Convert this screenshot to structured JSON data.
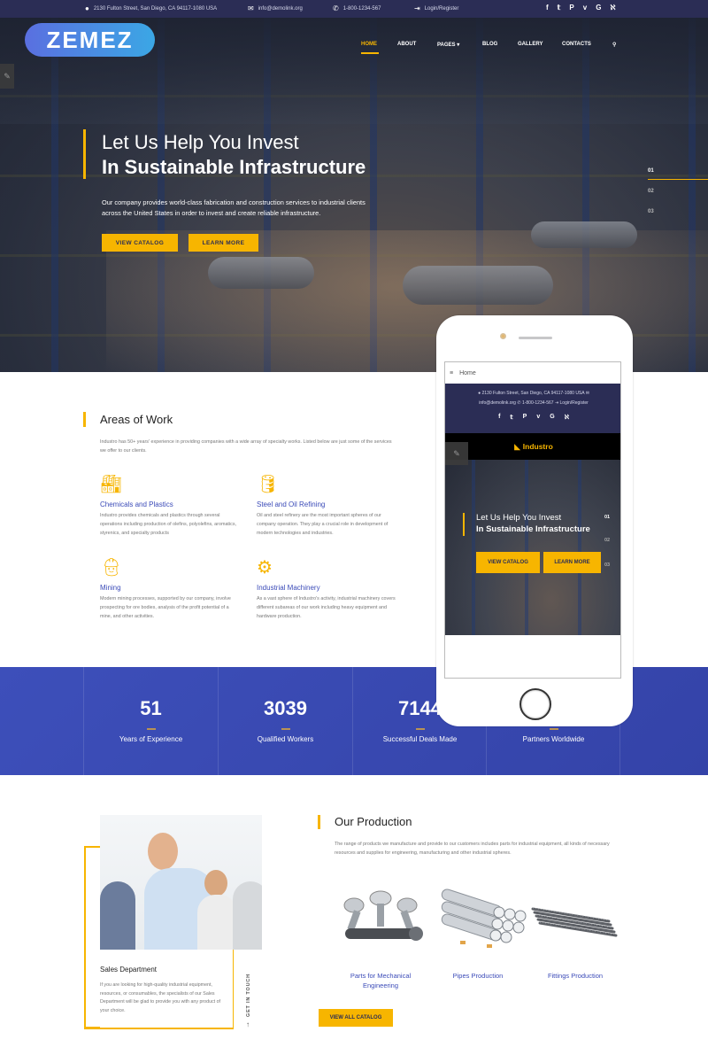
{
  "topbar": {
    "address": "2130 Fulton Street, San Diego, CA 94117-1080 USA",
    "email": "info@demolink.org",
    "phone": "1-800-1234-567",
    "login": "Login/Register",
    "social_icons": [
      "facebook-icon",
      "twitter-icon",
      "pinterest-icon",
      "vimeo-icon",
      "google-icon",
      "rss-icon"
    ],
    "social_glyphs": [
      "f",
      "𝕥",
      "P",
      "v",
      "G",
      "ℵ"
    ]
  },
  "brand": {
    "logo_text": "ZEMEZ"
  },
  "nav": {
    "items": [
      "HOME",
      "ABOUT",
      "PAGES",
      "BLOG",
      "GALLERY",
      "CONTACTS"
    ],
    "active": "HOME",
    "pages_dropdown_glyph": "▾",
    "search_glyph": "⚲"
  },
  "hero": {
    "title_line1": "Let Us Help You Invest",
    "title_line2": "In Sustainable Infrastructure",
    "text": "Our company provides world-class fabrication and construction services to industrial clients across the United States in order to invest and create reliable infrastructure.",
    "buttons": [
      "VIEW CATALOG",
      "LEARN MORE"
    ],
    "slides": [
      "01",
      "02",
      "03"
    ],
    "active_slide": "01"
  },
  "areas": {
    "title": "Areas of Work",
    "intro": "Industro has 50+ years' experience in providing companies with a wide array of specialty works. Listed below are just some of the services we offer to our clients.",
    "items": [
      {
        "icon": "factory-icon",
        "title": "Chemicals and Plastics",
        "text": "Industro provides chemicals and plastics through several operations including production of olefins, polyolefins, aromatics, styrenics, and specialty products"
      },
      {
        "icon": "oil-can-icon",
        "title": "Steel and Oil Refining",
        "text": "Oil and steel refinery are the most important spheres of our company operation. They play a crucial role in development of modern technologies and industries."
      },
      {
        "icon": "worker-helmet-icon",
        "title": "Mining",
        "text": "Modern mining processes, supported by our company, involve prospecting for ore bodies, analysis of the profit potential of a mine, and other activities."
      },
      {
        "icon": "gear-icon",
        "title": "Industrial Machinery",
        "text": "As a vast sphere of Industro's activity, industrial machinery covers different subareas of our work including heavy equipment and hardware production."
      }
    ]
  },
  "stats": [
    {
      "value": "51",
      "label": "Years of Experience"
    },
    {
      "value": "3039",
      "label": "Qualified Workers"
    },
    {
      "value": "7144",
      "label": "Successful Deals Made"
    },
    {
      "value": "",
      "label": "Partners Worldwide"
    }
  ],
  "mobile": {
    "menu_label": "Home",
    "address_line": "2130 Fulton Street, San Diego, CA 94117-1080 USA",
    "contact_line_email": "info@demolink.org",
    "contact_line_phone": "1-800-1234-567",
    "contact_line_login": "Login/Register",
    "brand": "Industro",
    "title_line1": "Let Us Help You Invest",
    "title_line2": "In Sustainable Infrastructure",
    "buttons": [
      "VIEW CATALOG",
      "LEARN MORE"
    ],
    "slides": [
      "01",
      "02",
      "03"
    ]
  },
  "sales": {
    "title": "Sales Department",
    "text": "If you are looking for high-quality industrial equipment, resources, or consumables, the specialists of our Sales Department will be glad to provide you with any product of your choice.",
    "get_in_touch": "GET IN TOUCH"
  },
  "production": {
    "title": "Our Production",
    "intro": "The range of products we manufacture and provide to our customers includes parts for industrial equipment, all kinds of necessary resources and supplies for engineering, manufacturing and other industrial spheres.",
    "items": [
      {
        "label": "Parts for Mechanical Engineering",
        "image": "engine-pistons-image"
      },
      {
        "label": "Pipes Production",
        "image": "steel-pipes-image"
      },
      {
        "label": "Fittings Production",
        "image": "rebar-fittings-image"
      }
    ],
    "button": "VIEW ALL CATALOG"
  },
  "colors": {
    "accent": "#f7b500",
    "navy": "#2b2d55",
    "blue": "#3b4bb8"
  }
}
